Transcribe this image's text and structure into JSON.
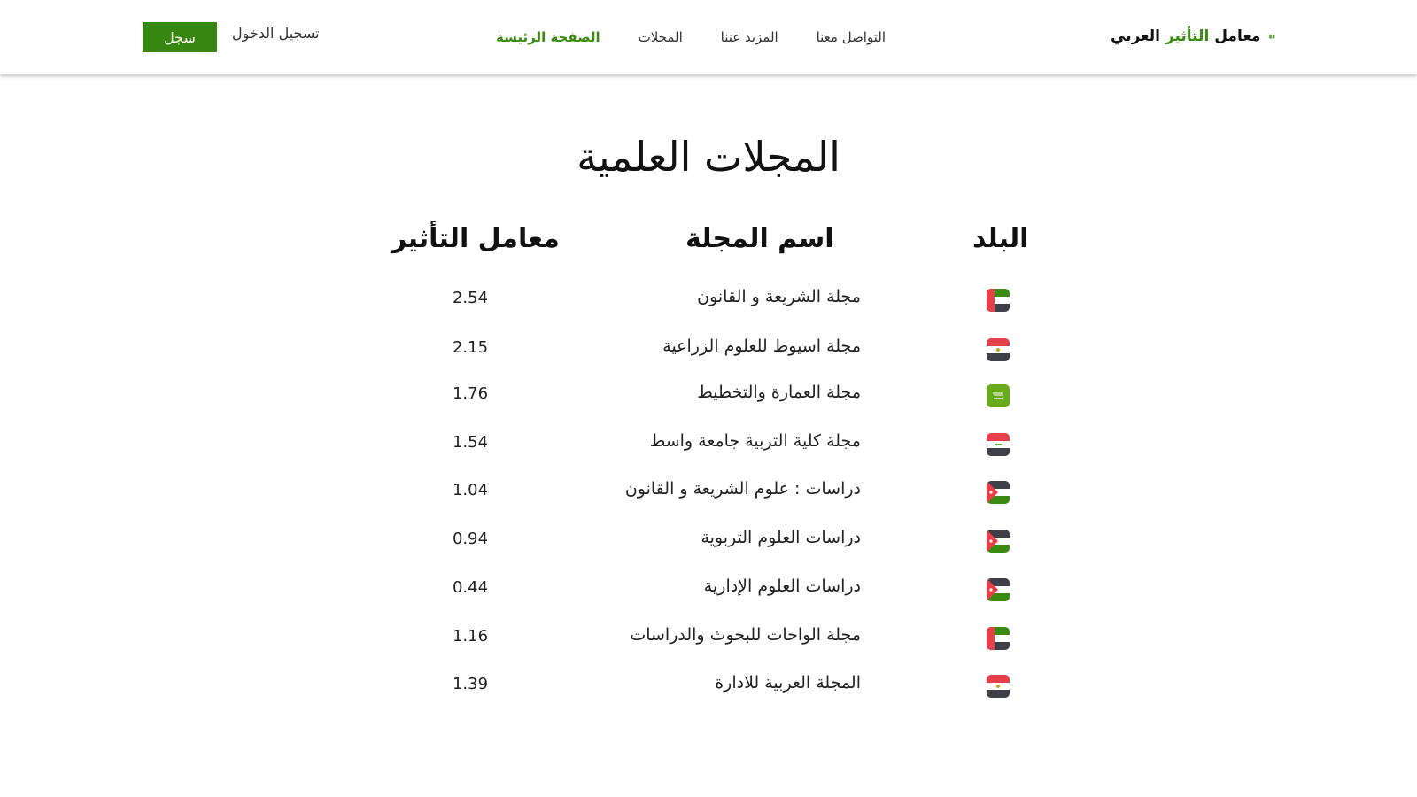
{
  "header": {
    "logo": {
      "part1": "معامل",
      "part2": "التأثير",
      "part3": "العربي"
    },
    "nav": [
      {
        "label": "الصفحة الرئيسة",
        "active": true
      },
      {
        "label": "المجلات",
        "active": false
      },
      {
        "label": "المزيد عننا",
        "active": false
      },
      {
        "label": "التواصل معنا",
        "active": false
      }
    ],
    "login_label": "تسجيل الدخول",
    "register_label": "سجل",
    "accent_color": "#36860f"
  },
  "main": {
    "title": "المجلات العلمية",
    "columns": {
      "country": "البلد",
      "name": "اسم المجلة",
      "factor": "معامل التأثير"
    },
    "rows": [
      {
        "flag": "uae-flag",
        "name": "مجلة الشريعة و القانون",
        "factor": "2.54"
      },
      {
        "flag": "egypt-flag",
        "name": "مجلة اسيوط للعلوم الزراعية",
        "factor": "2.15"
      },
      {
        "flag": "saudi-flag",
        "name": "مجلة العمارة والتخطيط",
        "factor": "1.76"
      },
      {
        "flag": "iraq-flag",
        "name": "مجلة كلية التربية جامعة واسط",
        "factor": "1.54"
      },
      {
        "flag": "jordan-flag",
        "name": "دراسات : علوم الشريعة و القانون",
        "factor": "1.04"
      },
      {
        "flag": "jordan-flag",
        "name": "دراسات العلوم التربوية",
        "factor": "0.94"
      },
      {
        "flag": "jordan-flag",
        "name": "دراسات العلوم الإدارية",
        "factor": "0.44"
      },
      {
        "flag": "uae-flag",
        "name": "مجلة الواحات  للبحوث والدراسات",
        "factor": "1.16"
      },
      {
        "flag": "egypt-flag",
        "name": "المجلة العربية للادارة",
        "factor": "1.39"
      }
    ]
  }
}
